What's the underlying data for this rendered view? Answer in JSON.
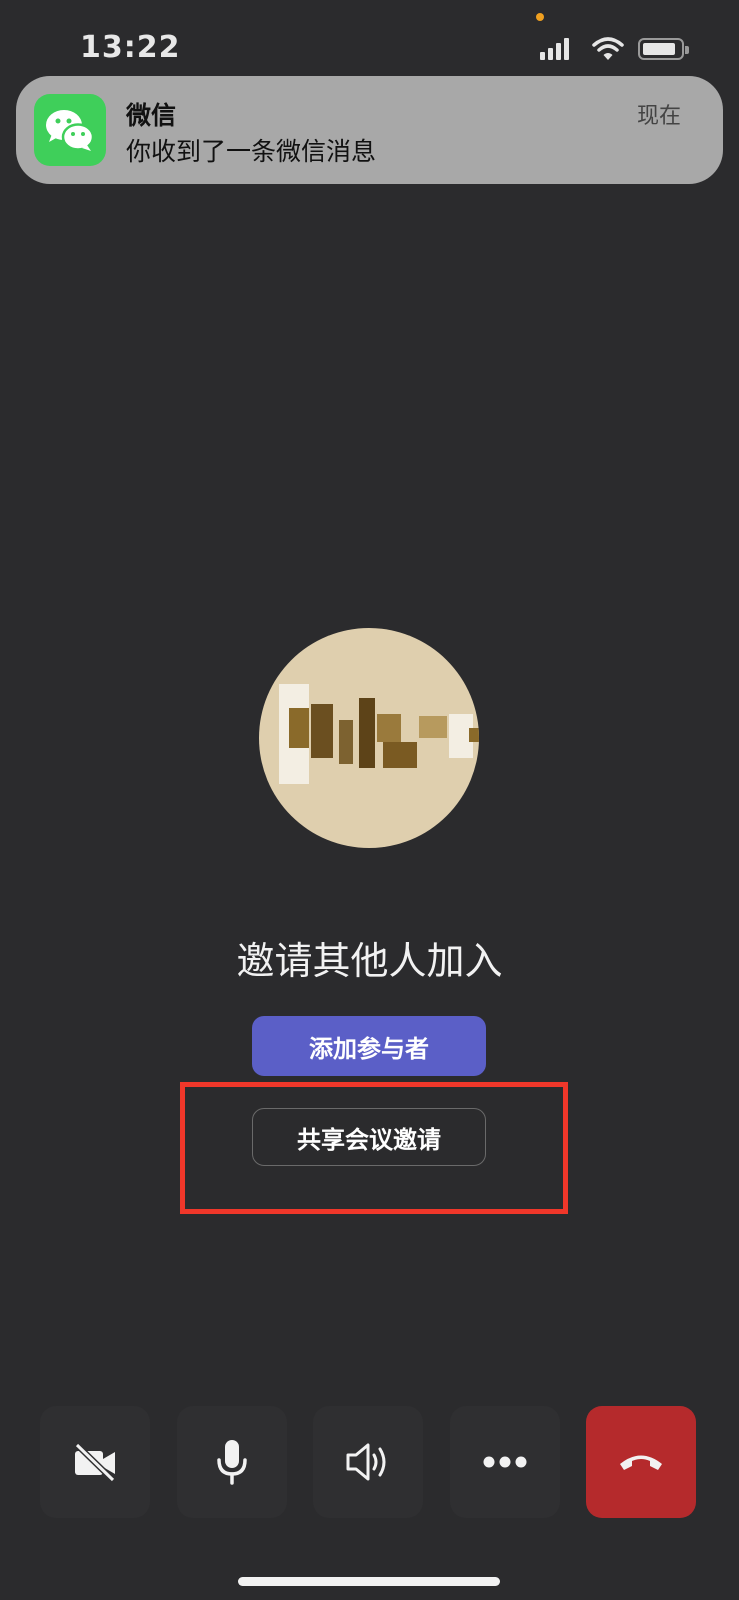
{
  "status_bar": {
    "time": "13:22",
    "privacy_dot_color": "#f0a020"
  },
  "notification": {
    "app": "微信",
    "message": "你收到了一条微信消息",
    "time": "现在",
    "icon": "wechat-icon"
  },
  "meeting": {
    "invite_title": "邀请其他人加入",
    "add_participants_label": "添加参与者",
    "share_invite_label": "共享会议邀请"
  },
  "controls": {
    "camera_icon": "camera-off-icon",
    "mic_icon": "microphone-icon",
    "speaker_icon": "speaker-icon",
    "more_icon": "more-icon",
    "hangup_icon": "hang-up-icon"
  },
  "colors": {
    "background": "#2b2b2d",
    "accent": "#5b5fc7",
    "hangup": "#b52a2c",
    "highlight": "#f0372a"
  }
}
